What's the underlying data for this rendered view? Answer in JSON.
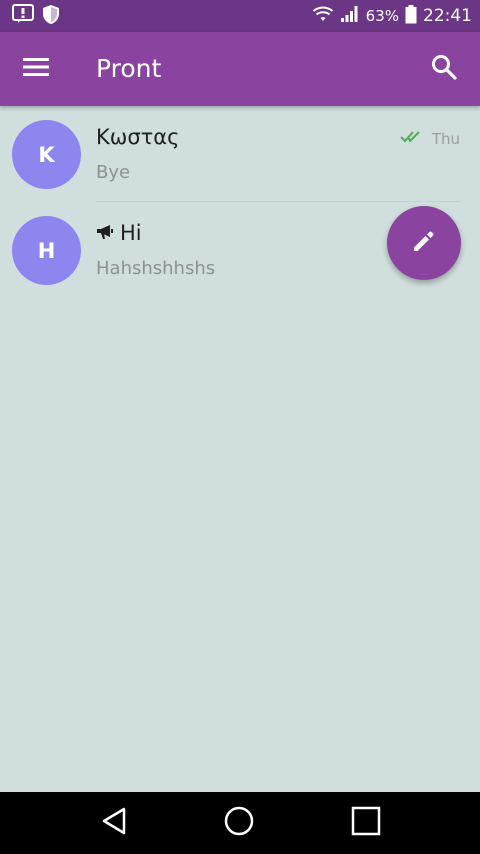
{
  "status_bar": {
    "icons_left": [
      "alert-icon",
      "shield-icon"
    ],
    "icons_right": [
      "wifi-icon",
      "signal-icon",
      "battery-icon"
    ],
    "battery_percent": "63%",
    "time": "22:41"
  },
  "app_bar": {
    "title": "Pront",
    "menu_icon": "menu-icon",
    "search_icon": "search-icon"
  },
  "chats": [
    {
      "initial": "K",
      "name": "Κωστας",
      "preview": "Bye",
      "time": "Thu",
      "status_icon": "double-check-icon"
    },
    {
      "initial": "H",
      "name": "Hi",
      "name_icon": "megaphone-icon",
      "preview": "Hahshshhshs"
    }
  ],
  "fab": {
    "icon": "pencil-icon"
  },
  "nav_bar": {
    "icons": [
      "back-icon",
      "home-icon",
      "recents-icon"
    ]
  },
  "colors": {
    "status_bar": "#6b3685",
    "app_bar": "#8a44a0",
    "background": "#d1dede",
    "avatar": "#8d86ee",
    "check": "#4caf50"
  }
}
